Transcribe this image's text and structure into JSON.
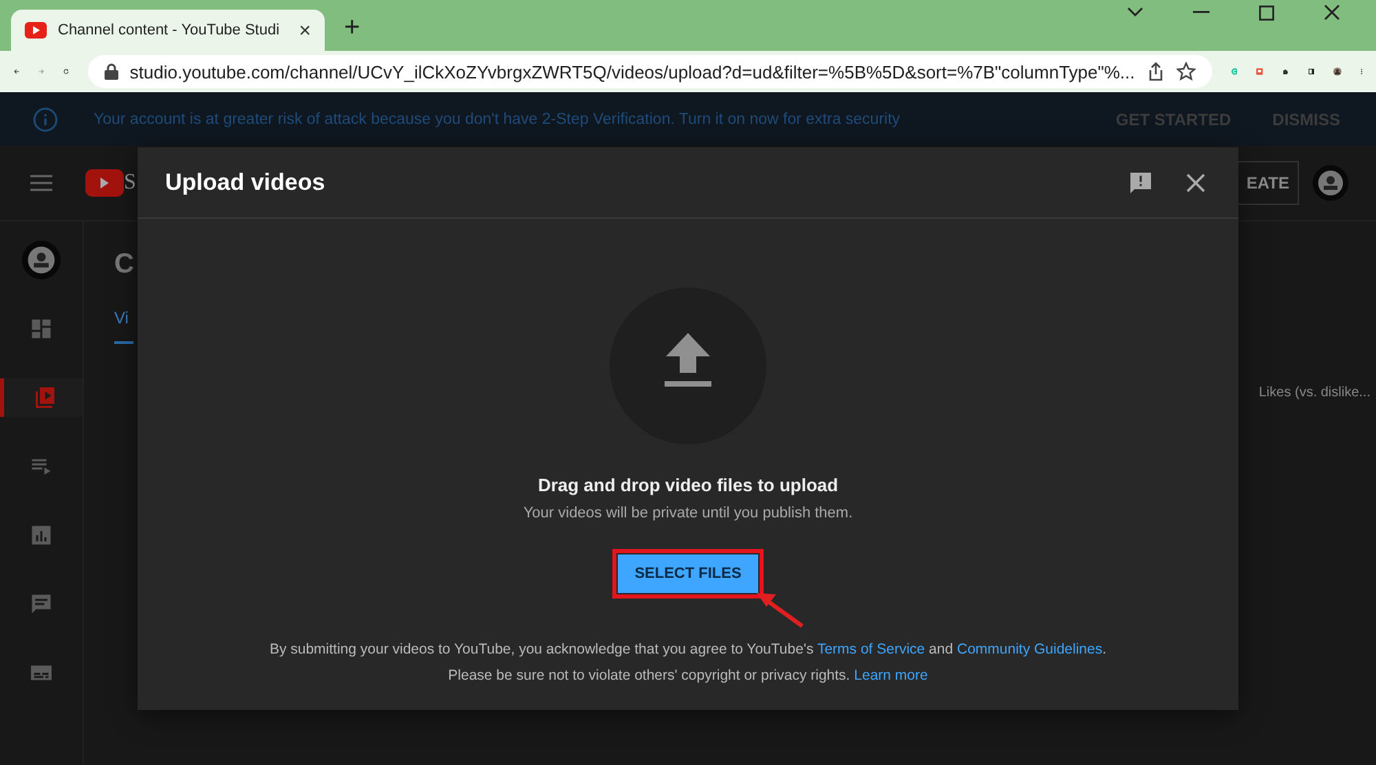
{
  "browser": {
    "tab_title": "Channel content - YouTube Studi",
    "tab_close": "×",
    "new_tab": "+",
    "url": "studio.youtube.com/channel/UCvY_ilCkXoZYvbrgxZWRT5Q/videos/upload?d=ud&filter=%5B%5D&sort=%7B\"columnType\"%..."
  },
  "banner": {
    "message": "Your account is at greater risk of attack because you don't have 2-Step Verification. Turn it on now for extra security",
    "actions": [
      "GET STARTED",
      "DISMISS"
    ]
  },
  "studio": {
    "logo_text": "S",
    "page_heading": "C",
    "tab_label": "Vi",
    "create_button": "EATE",
    "column_header": "Likes (vs. dislike...",
    "sidebar_items": [
      {
        "selected": false
      },
      {
        "selected": true
      },
      {
        "selected": false
      },
      {
        "selected": false
      },
      {
        "selected": false
      },
      {
        "selected": false
      }
    ]
  },
  "dialog": {
    "title": "Upload videos",
    "heading": "Drag and drop video files to upload",
    "subtext": "Your videos will be private until you publish them.",
    "button": "SELECT FILES",
    "legal_1": {
      "before": "By submitting your videos to YouTube, you acknowledge that you agree to YouTube's ",
      "link_1": "Terms of Service",
      "middle": " and ",
      "link_2": "Community Guidelines",
      "after": "."
    },
    "legal_2": {
      "before": "Please be sure not to violate others' copyright or privacy rights. ",
      "link": "Learn more"
    }
  }
}
